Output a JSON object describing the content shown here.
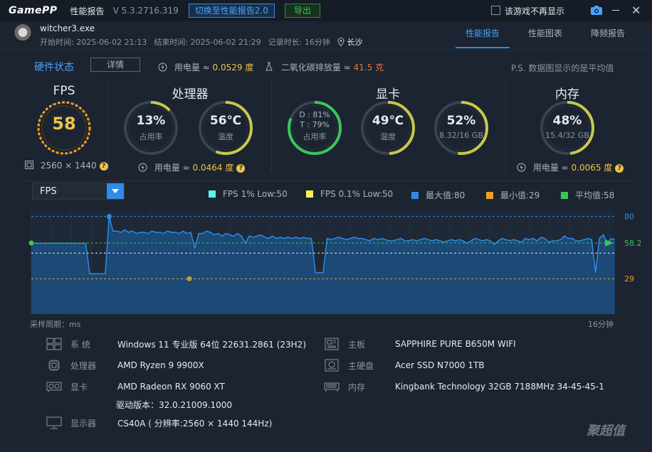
{
  "titlebar": {
    "logo": "GamePP",
    "title": "性能报告",
    "version": "V 5.3.2716.319",
    "switch_btn": "切换至性能报告2.0",
    "export_btn": "导出",
    "no_show_label": "该游戏不再显示",
    "close": "✕"
  },
  "game": {
    "name": "witcher3.exe",
    "start": "开始时间: 2025-06-02 21:13",
    "end": "结束时间: 2025-06-02 21:29",
    "duration": "记录时长: 16分钟",
    "city": "长沙"
  },
  "tabs": [
    "性能报告",
    "性能图表",
    "降频报告"
  ],
  "hardware": {
    "title": "硬件状态",
    "detail_btn": "详情",
    "power_label": "用电量 ≈",
    "power_value": "0.0529 度",
    "co2_label": "二氧化碳排放量 ≈",
    "co2_value": "41.5 克",
    "note": "P.S. 数据图显示的是平均值"
  },
  "sections": {
    "fps": "FPS",
    "cpu": "处理器",
    "gpu": "显卡",
    "mem": "内存"
  },
  "gauges": {
    "fps": {
      "value": "58",
      "level": 1.0
    },
    "resolution": "2560 × 1440",
    "cpu_usage": {
      "value": "13%",
      "sub": "占用率",
      "level": 0.13
    },
    "cpu_temp": {
      "value": "56℃",
      "sub": "温度",
      "level": 0.56
    },
    "gpu_usage": {
      "d": "D : 81%",
      "t": "T : 79%",
      "sub": "占用率",
      "level": 0.81
    },
    "gpu_temp": {
      "value": "49℃",
      "sub": "温度",
      "level": 0.49
    },
    "gpu_mem": {
      "value": "52%",
      "sub": "8.32/16 GB",
      "level": 0.52
    },
    "mem": {
      "value": "48%",
      "sub": "15.4/32 GB",
      "level": 0.48
    },
    "cpu_power_label": "用电量 ≈",
    "cpu_power": "0.0464 度",
    "mem_power_label": "用电量 ≈",
    "mem_power": "0.0065 度"
  },
  "chart": {
    "select": "FPS",
    "legend": [
      {
        "label": "FPS 1% Low:50",
        "color": "#5ff0e8"
      },
      {
        "label": "FPS 0.1% Low:50",
        "color": "#f6ef55"
      },
      {
        "label": "最大值:80",
        "color": "#2f8be6"
      },
      {
        "label": "最小值:29",
        "color": "#f0a020"
      },
      {
        "label": "平均值:58",
        "color": "#3cc45a"
      }
    ],
    "axis_left": "采样周期：ms",
    "axis_right": "16分钟"
  },
  "chart_data": {
    "type": "area",
    "title": "",
    "xlabel": "采样周期：ms",
    "xrange_label": "16分钟",
    "ylim": [
      29,
      80
    ],
    "reference_lines": [
      {
        "name": "最大值",
        "value": 80
      },
      {
        "name": "平均值",
        "value": 58.28
      },
      {
        "name": "FPS 1% Low",
        "value": 50
      },
      {
        "name": "最小值",
        "value": 29
      }
    ],
    "series": [
      {
        "name": "FPS",
        "values": [
          58,
          58,
          58,
          58,
          58,
          58,
          58,
          58,
          58,
          58,
          58,
          58,
          58,
          58,
          58,
          33,
          33,
          33,
          33,
          33,
          80,
          68,
          68,
          67,
          69,
          67,
          68,
          66,
          67,
          67,
          66,
          68,
          67,
          67,
          66,
          68,
          67,
          67,
          66,
          68,
          66,
          67,
          54,
          66,
          66,
          68,
          67,
          65,
          66,
          64,
          66,
          65,
          64,
          66,
          64,
          58,
          64,
          63,
          64,
          65,
          63,
          62,
          64,
          62,
          63,
          62,
          63,
          62,
          63,
          62,
          63,
          62,
          62,
          34,
          34,
          34,
          62,
          61,
          62,
          63,
          62,
          61,
          62,
          63,
          62,
          62,
          61,
          60,
          62,
          61,
          62,
          61,
          60,
          60,
          61,
          62,
          60,
          60,
          61,
          60,
          61,
          62,
          61,
          60,
          61,
          60,
          59,
          60,
          61,
          60,
          61,
          60,
          58,
          60,
          62,
          61,
          60,
          61,
          60,
          57,
          60,
          62,
          61,
          60,
          61,
          60,
          59,
          62,
          61,
          62,
          60,
          63,
          62,
          59,
          60,
          60,
          61,
          64,
          62,
          62,
          60,
          60,
          61,
          62,
          61,
          34,
          62,
          65,
          58,
          62,
          61
        ]
      }
    ]
  },
  "sysinfo": [
    {
      "label": "系  统",
      "value": "Windows 11 专业版 64位 22631.2861 (23H2)"
    },
    {
      "label": "处理器",
      "value": "AMD Ryzen 9 9900X"
    },
    {
      "label": "显卡",
      "value": "AMD Radeon RX 9060 XT"
    },
    {
      "label": "",
      "value": "驱动版本：32.0.21009.1000"
    },
    {
      "label": "显示器",
      "value": "CS40A ( 分辨率:2560 × 1440 144Hz)"
    },
    {
      "label": "主板",
      "value": "SAPPHIRE PURE B650M WIFI"
    },
    {
      "label": "主硬盘",
      "value": "Acer SSD N7000 1TB"
    },
    {
      "label": "内存",
      "value": "Kingbank Technology 32GB 7188MHz 34-45-45-1"
    }
  ],
  "watermark": "聚超值"
}
